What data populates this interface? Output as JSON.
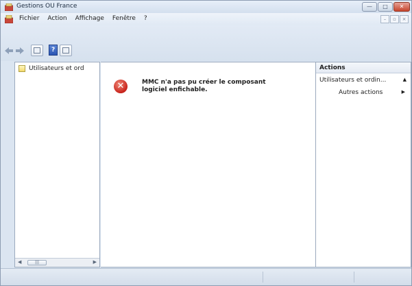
{
  "window": {
    "title": "Gestions OU France",
    "buttons": {
      "minimize": "—",
      "maximize": "□",
      "close": "✕"
    }
  },
  "menu": {
    "items": [
      "Fichier",
      "Action",
      "Affichage",
      "Fenêtre",
      "?"
    ],
    "child_buttons": {
      "minimize": "–",
      "restore": "▫",
      "close": "×"
    }
  },
  "toolbar": {
    "back_icon": "back-arrow-icon",
    "forward_icon": "forward-arrow-icon",
    "show_hide_tree_icon": "console-tree-icon",
    "help_icon": "help-icon",
    "help_glyph": "?",
    "show_hide_action_icon": "action-pane-icon"
  },
  "tree": {
    "root_label": "Utilisateurs et ord",
    "scrollbar": {
      "thumb_grip": "|||"
    }
  },
  "center": {
    "error_icon": "error-icon",
    "error_glyph": "✕",
    "message": "MMC n'a pas pu créer le composant logiciel enfichable."
  },
  "actions": {
    "header": "Actions",
    "group_label": "Utilisateurs et ordin...",
    "group_caret": "▲",
    "item_label": "Autres actions",
    "item_caret": "▶"
  },
  "colors": {
    "error": "#c8221a",
    "window_bg": "#dbe5f1"
  }
}
